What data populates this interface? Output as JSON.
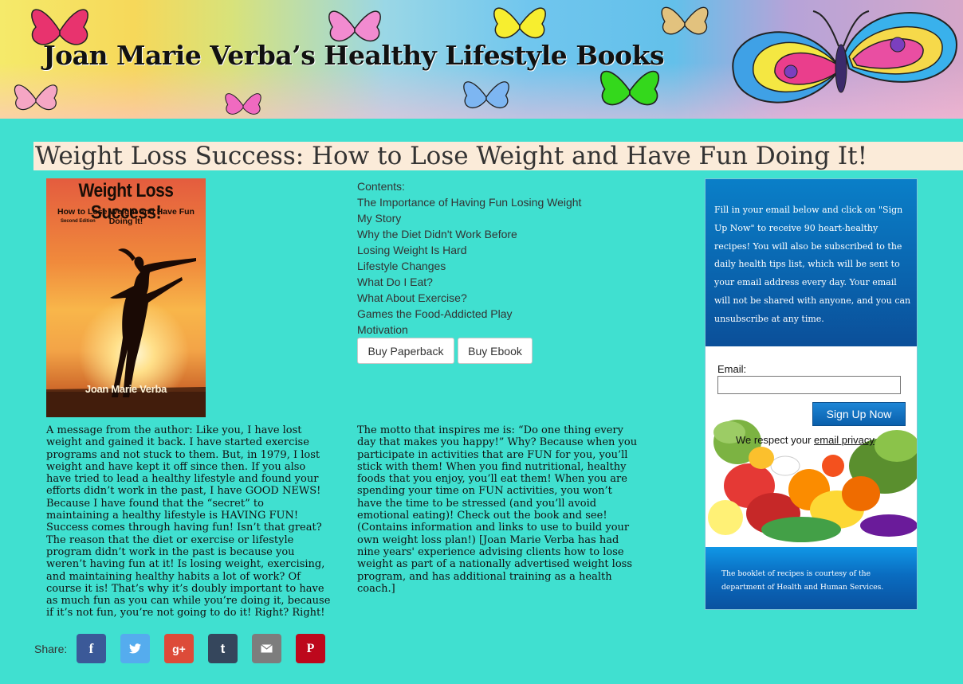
{
  "banner": {
    "title": "Joan Marie Verba’s  Healthy Lifestyle Books"
  },
  "page_title": "Weight Loss Success: How to Lose Weight and Have Fun Doing It!",
  "book_cover": {
    "title": "Weight Loss Success!",
    "subtitle": "How to Lose Weight and Have Fun Doing It!",
    "edition": "Second Edition",
    "author": "Joan Marie Verba"
  },
  "contents": {
    "heading": "Contents:",
    "items": [
      "The Importance of Having Fun Losing Weight",
      "My Story",
      "Why the Diet Didn't Work Before",
      "Losing Weight Is Hard",
      "Lifestyle Changes",
      "What Do I Eat?",
      "What About Exercise?",
      "Games the Food-Addicted Play",
      "Motivation"
    ]
  },
  "buttons": {
    "paperback": "Buy Paperback",
    "ebook": "Buy Ebook"
  },
  "author_message": [
    "A message from the author: Like you, I have lost",
    "weight and gained it back. I have started exercise",
    "programs and not stuck to them. But, in 1979, I lost",
    "weight and have kept it off since then. If you also",
    "have tried to lead a healthy lifestyle and found your",
    "efforts didn’t work in the past, I have GOOD NEWS!",
    "Because I have found that the “secret” to",
    "maintaining a healthy lifestyle is HAVING FUN!",
    "Success comes through having fun! Isn’t that great?",
    "The reason that the diet or exercise or lifestyle",
    "program didn’t work in the past is because you",
    "weren’t having fun at it! Is losing weight, exercising,",
    "and maintaining healthy habits a lot of work? Of",
    "course it is! That’s why it’s doubly important to have",
    "as much fun as you can while you’re doing it, because",
    "if it’s not fun, you’re not going to do it! Right? Right!"
  ],
  "motto": [
    "The motto that inspires me is: “Do one thing every",
    "day that makes you happy!” Why? Because when you",
    "participate in activities that are FUN for you, you’ll",
    "stick with them! When you find nutritional, healthy",
    "foods that you enjoy, you’ll eat them! When you are",
    "spending your time on FUN activities, you won’t",
    "have the time to be stressed (and you’ll avoid",
    "emotional eating)! Check out the book and see!",
    "(Contains information and links to use to build your",
    "own weight loss plan!) [Joan Marie Verba has had",
    "nine years' experience advising clients how to lose",
    "weight as part of a nationally advertised weight loss",
    "program, and has additional training as a health",
    "coach.]"
  ],
  "share": {
    "label": "Share:",
    "buttons": [
      {
        "name": "facebook",
        "glyph": "f",
        "color": "#3b5998"
      },
      {
        "name": "twitter",
        "glyph": "❧",
        "color": "#55acee"
      },
      {
        "name": "google-plus",
        "glyph": "g+",
        "color": "#dd4b39"
      },
      {
        "name": "tumblr",
        "glyph": "t",
        "color": "#35465c"
      },
      {
        "name": "email",
        "glyph": "✉",
        "color": "#7d7d7d"
      },
      {
        "name": "pinterest",
        "glyph": "P",
        "color": "#bd081c"
      }
    ]
  },
  "signup": {
    "intro": "Fill in your email below and click on \"Sign Up Now\" to receive 90 heart-healthy recipes! You will also be subscribed to the daily health tips list, which will be sent to your email address every day. Your email will not be shared with anyone, and you can unsubscribe at any time.",
    "email_label": "Email:",
    "email_value": "",
    "submit_label": "Sign Up Now",
    "respect_prefix": "We respect your ",
    "respect_link": "email privacy",
    "credit": "The booklet of recipes is courtesy of the department of Health and Human Services."
  }
}
